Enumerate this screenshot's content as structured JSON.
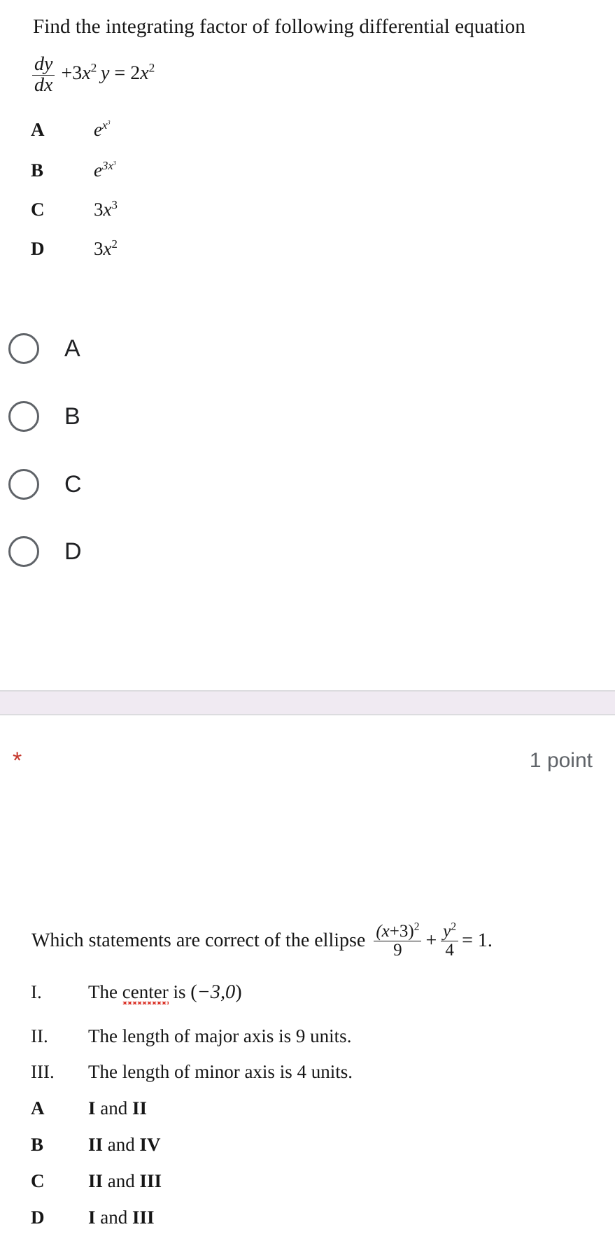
{
  "question1": {
    "stem": "Find the integrating factor of following differential equation",
    "equation": {
      "fraction_numerator": "dy",
      "fraction_denominator": "dx",
      "rest": "+ 3x²y = 2x²",
      "plain": "dy/dx + 3x^2 y = 2x^2"
    },
    "image_options": [
      {
        "letter": "A",
        "value_plain": "e^(x^3)",
        "base": "e",
        "exp_base": "x",
        "exp_sup": "3",
        "coef": ""
      },
      {
        "letter": "B",
        "value_plain": "e^(3x^3)",
        "base": "e",
        "exp_base": "x",
        "exp_sup": "3",
        "coef": "3"
      },
      {
        "letter": "C",
        "value_plain": "3x^3",
        "base": "",
        "exp_base": "x",
        "exp_sup": "3",
        "coef": "3"
      },
      {
        "letter": "D",
        "value_plain": "3x^2",
        "base": "",
        "exp_base": "x",
        "exp_sup": "2",
        "coef": "3"
      }
    ],
    "radio_options": [
      {
        "label": "A",
        "selected": false
      },
      {
        "label": "B",
        "selected": false
      },
      {
        "label": "C",
        "selected": false
      },
      {
        "label": "D",
        "selected": false
      }
    ]
  },
  "divider": {
    "band_color": "#f0eaf2",
    "border_color": "#dcdcdf"
  },
  "question2": {
    "required_marker": "*",
    "required_marker_color": "#c5372c",
    "points": "1 point",
    "points_color": "#5f6368",
    "stem_prefix": "Which statements are correct of the ellipse",
    "equation": {
      "term1_numerator": "(x+3)",
      "term1_num_sup": "2",
      "term1_denominator": "9",
      "plus": "+",
      "term2_numerator": "y",
      "term2_num_sup": "2",
      "term2_denominator": "4",
      "equals": "= 1.",
      "plain": "(x+3)^2/9 + y^2/4 = 1."
    },
    "statements": [
      {
        "numeral": "I.",
        "text_before": "The ",
        "misspelled": "center",
        "text_after": " is ",
        "math": "(−3,0)"
      },
      {
        "numeral": "II.",
        "text": "The length of major axis is 9 units."
      },
      {
        "numeral": "III.",
        "text": "The length of minor axis is 4 units."
      }
    ],
    "options": [
      {
        "letter": "A",
        "value": "I and II",
        "bold_parts": [
          "I",
          "II"
        ]
      },
      {
        "letter": "B",
        "value": "II and IV",
        "bold_parts": [
          "II",
          "IV"
        ]
      },
      {
        "letter": "C",
        "value": "II and III",
        "bold_parts": [
          "II",
          "III"
        ]
      },
      {
        "letter": "D",
        "value": "I and III",
        "bold_parts": [
          "I",
          "III"
        ]
      }
    ]
  }
}
